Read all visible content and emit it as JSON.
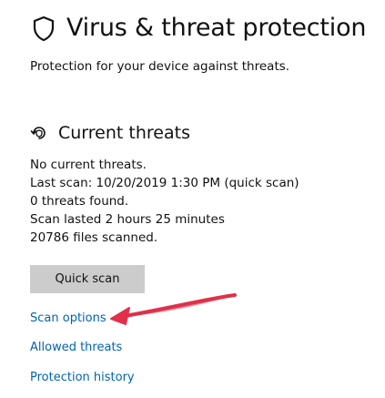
{
  "page": {
    "title": "Virus & threat protection",
    "subtitle": "Protection for your device against threats.",
    "title_icon": "shield-icon"
  },
  "current_threats": {
    "heading": "Current threats",
    "heading_icon": "refresh-shield-icon",
    "status_lines": [
      "No current threats.",
      "Last scan: 10/20/2019 1:30 PM (quick scan)",
      "0 threats found.",
      "Scan lasted 2 hours 25 minutes",
      "20786 files scanned."
    ],
    "quick_scan_label": "Quick scan"
  },
  "links": {
    "scan_options": "Scan options",
    "allowed_threats": "Allowed threats",
    "protection_history": "Protection history"
  },
  "annotation": {
    "type": "arrow",
    "color": "#e0304a",
    "points_to": "scan_options"
  },
  "colors": {
    "link": "#0063b1",
    "button_bg": "#cccccc",
    "text": "#111111"
  }
}
